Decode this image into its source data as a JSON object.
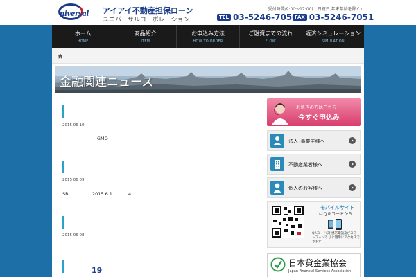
{
  "header": {
    "logo_text": "niversal",
    "company_name": "アイアイ不動産担保ローン",
    "company_kana": "ユニバーサルコーポレーション",
    "hours": "受付時間/9:00〜17:00(土日祝日,年末年始を除く)",
    "tel_label": "TEL",
    "tel_number": "03-5246-7050",
    "fax_label": "FAX",
    "fax_number": "03-5246-7051"
  },
  "nav": {
    "items": [
      {
        "jp": "ホーム",
        "en": "HOME"
      },
      {
        "jp": "商品紹介",
        "en": "ITEM"
      },
      {
        "jp": "お申込み方法",
        "en": "HOW TO ORDER"
      },
      {
        "jp": "ご融資までの流れ",
        "en": "FLOW"
      },
      {
        "jp": "返済シミュレーション",
        "en": "SIMULATION"
      }
    ]
  },
  "banner": {
    "title": "金融関連ニュース"
  },
  "news": [
    {
      "date": "2015 06 10",
      "text": "GMO"
    },
    {
      "date": "2015 06 09",
      "text_left": "SBI",
      "text_mid": "2015 6 1",
      "text_right": "4"
    },
    {
      "date": "2015 06 08",
      "big": "19"
    }
  ],
  "sidebar": {
    "apply_sub": "お急ぎの方はこちら",
    "apply_main": "今すぐ申込み",
    "buttons": [
      {
        "label": "法人･事業主様へ"
      },
      {
        "label": "不動産業者様へ"
      },
      {
        "label": "個人のお客様へ"
      }
    ],
    "mobile_title": "モバイルサイト",
    "mobile_sub": "はＱＲコードから",
    "qr_note": "QRコード(対)携帯電話及びスマートフォンで 小に簡単にアクセスできます！",
    "assoc_jp": "日本貸金業協会",
    "assoc_en": "Japan Financial Services Association"
  },
  "colors": {
    "brand_blue": "#1b3c8c",
    "band_blue": "#1d6fa8",
    "accent_cyan": "#2aa3c9",
    "apply_pink": "#d83d6c"
  }
}
